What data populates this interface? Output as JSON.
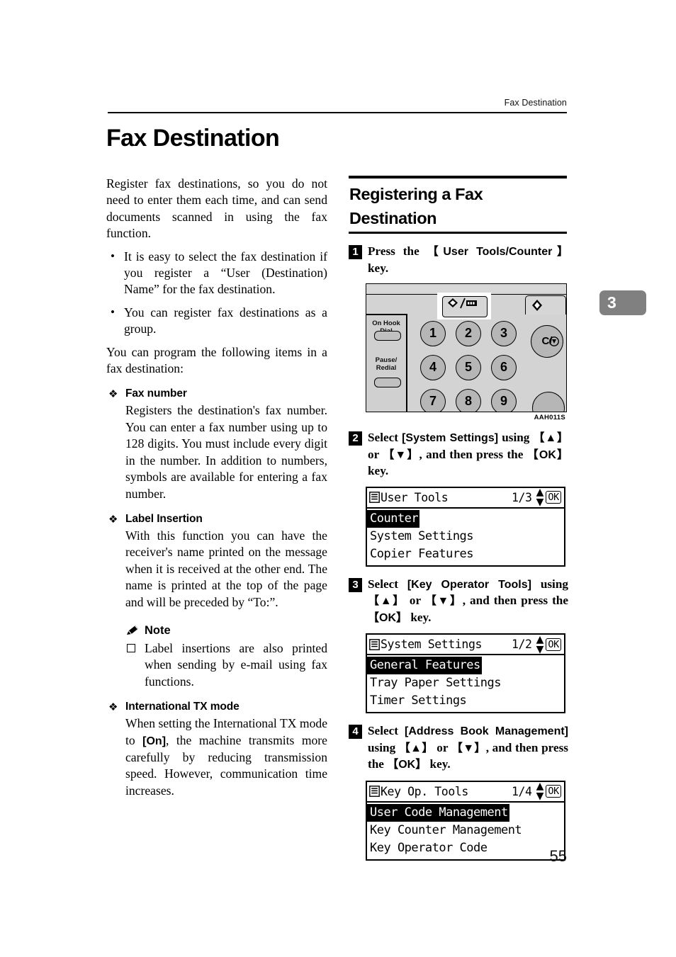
{
  "header": {
    "running_head": "Fax Destination"
  },
  "chapter": {
    "title": "Fax Destination",
    "thumb_tab_number": "3"
  },
  "left_column": {
    "intro": "Register fax destinations, so you do not need to enter them each time, and can send documents scanned in using the fax function.",
    "bullets": [
      "It is easy to select the fax destination if you register a “User (Destination) Name” for the fax destination.",
      "You can register fax destinations as a group."
    ],
    "lead_in": "You can program the following items in a fax destination:",
    "sections": [
      {
        "glyph": "❖",
        "heading": "Fax number",
        "body": "Registers the destination's fax number. You can enter a fax number using up to 128 digits. You must include every digit in the number. In addition to numbers, symbols are available for entering a fax number."
      },
      {
        "glyph": "❖",
        "heading": "Label Insertion",
        "body": "With this function you can have the receiver's name printed on the message when it is received at the other end. The name is printed at the top of the page and will be preceded by “To:”."
      }
    ],
    "note": {
      "heading": "Note",
      "items": [
        "Label insertions are also printed when sending by e-mail using fax functions."
      ]
    },
    "section_international": {
      "glyph": "❖",
      "heading": "International TX mode",
      "body_before": "When setting the International TX mode to ",
      "body_key": "[On]",
      "body_after": ", the machine transmits more carefully by reducing transmission speed. However, communication time increases."
    }
  },
  "right_column": {
    "section_title": "Registering a Fax Destination",
    "steps": [
      {
        "number": "1",
        "text_parts": [
          {
            "t": "Press the ",
            "style": "serif"
          },
          {
            "t": "【User Tools/Counter】",
            "style": "key"
          },
          {
            "t": " key.",
            "style": "serif"
          }
        ]
      },
      {
        "number": "2",
        "text_parts": [
          {
            "t": "Select ",
            "style": "serif"
          },
          {
            "t": "[System Settings]",
            "style": "key"
          },
          {
            "t": " using ",
            "style": "serif"
          },
          {
            "t": "【▲】",
            "style": "key"
          },
          {
            "t": " or ",
            "style": "serif"
          },
          {
            "t": "【▼】",
            "style": "key"
          },
          {
            "t": ", and then press the ",
            "style": "serif"
          },
          {
            "t": "【OK】",
            "style": "key"
          },
          {
            "t": " key.",
            "style": "serif"
          }
        ]
      },
      {
        "number": "3",
        "text_parts": [
          {
            "t": "Select ",
            "style": "serif"
          },
          {
            "t": "[Key Operator Tools]",
            "style": "key"
          },
          {
            "t": " using ",
            "style": "serif"
          },
          {
            "t": "【▲】",
            "style": "key"
          },
          {
            "t": " or ",
            "style": "serif"
          },
          {
            "t": "【▼】",
            "style": "key"
          },
          {
            "t": ", and then press the ",
            "style": "serif"
          },
          {
            "t": "【OK】",
            "style": "key"
          },
          {
            "t": " key.",
            "style": "serif"
          }
        ]
      },
      {
        "number": "4",
        "text_parts": [
          {
            "t": "Select ",
            "style": "serif"
          },
          {
            "t": "[Address Book Management]",
            "style": "key"
          },
          {
            "t": " using ",
            "style": "serif"
          },
          {
            "t": "【▲】",
            "style": "key"
          },
          {
            "t": " or ",
            "style": "serif"
          },
          {
            "t": "【▼】",
            "style": "key"
          },
          {
            "t": ", and then press the ",
            "style": "serif"
          },
          {
            "t": "【OK】",
            "style": "key"
          },
          {
            "t": " key.",
            "style": "serif"
          }
        ]
      }
    ],
    "control_panel_figure": {
      "caption": "AAH011S",
      "side_labels": [
        "On Hook Dial",
        "Pause/\nRedial"
      ],
      "numpad_keys": [
        "1",
        "2",
        "3",
        "4",
        "5",
        "6",
        "7",
        "8",
        "9"
      ],
      "clear_key_label": "C/",
      "highlighted_key": "user-tools-counter"
    },
    "lcd_screens": [
      {
        "title": "User Tools",
        "page": "1/3",
        "ok_label": "OK",
        "rows": [
          {
            "label": "Counter",
            "selected": true
          },
          {
            "label": "System Settings",
            "selected": false
          },
          {
            "label": "Copier Features",
            "selected": false
          }
        ]
      },
      {
        "title": "System Settings",
        "page": "1/2",
        "ok_label": "OK",
        "rows": [
          {
            "label": "General Features",
            "selected": true
          },
          {
            "label": "Tray Paper Settings",
            "selected": false
          },
          {
            "label": "Timer Settings",
            "selected": false
          }
        ]
      },
      {
        "title": "Key Op. Tools",
        "page": "1/4",
        "ok_label": "OK",
        "rows": [
          {
            "label": "User Code Management",
            "selected": true
          },
          {
            "label": "Key Counter Management",
            "selected": false
          },
          {
            "label": "Key Operator Code",
            "selected": false
          }
        ]
      }
    ]
  },
  "folio": {
    "page_number": "55"
  }
}
